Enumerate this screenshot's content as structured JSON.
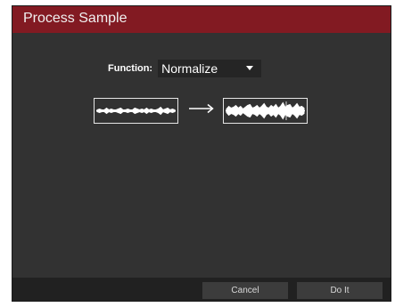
{
  "dialog": {
    "title": "Process Sample"
  },
  "function": {
    "label": "Function:",
    "selected": "Normalize",
    "dropdown_icon": "triangle-down"
  },
  "preview": {
    "before_icon": "waveform-original",
    "arrow_icon": "right-arrow",
    "after_icon": "waveform-normalized"
  },
  "buttons": {
    "cancel": "Cancel",
    "do_it": "Do It"
  },
  "colors": {
    "title_bar": "#821a22",
    "dialog_bg": "#323232",
    "footer_bg": "#212121",
    "button_bg": "#3c3c3c",
    "select_bg": "#252525"
  }
}
